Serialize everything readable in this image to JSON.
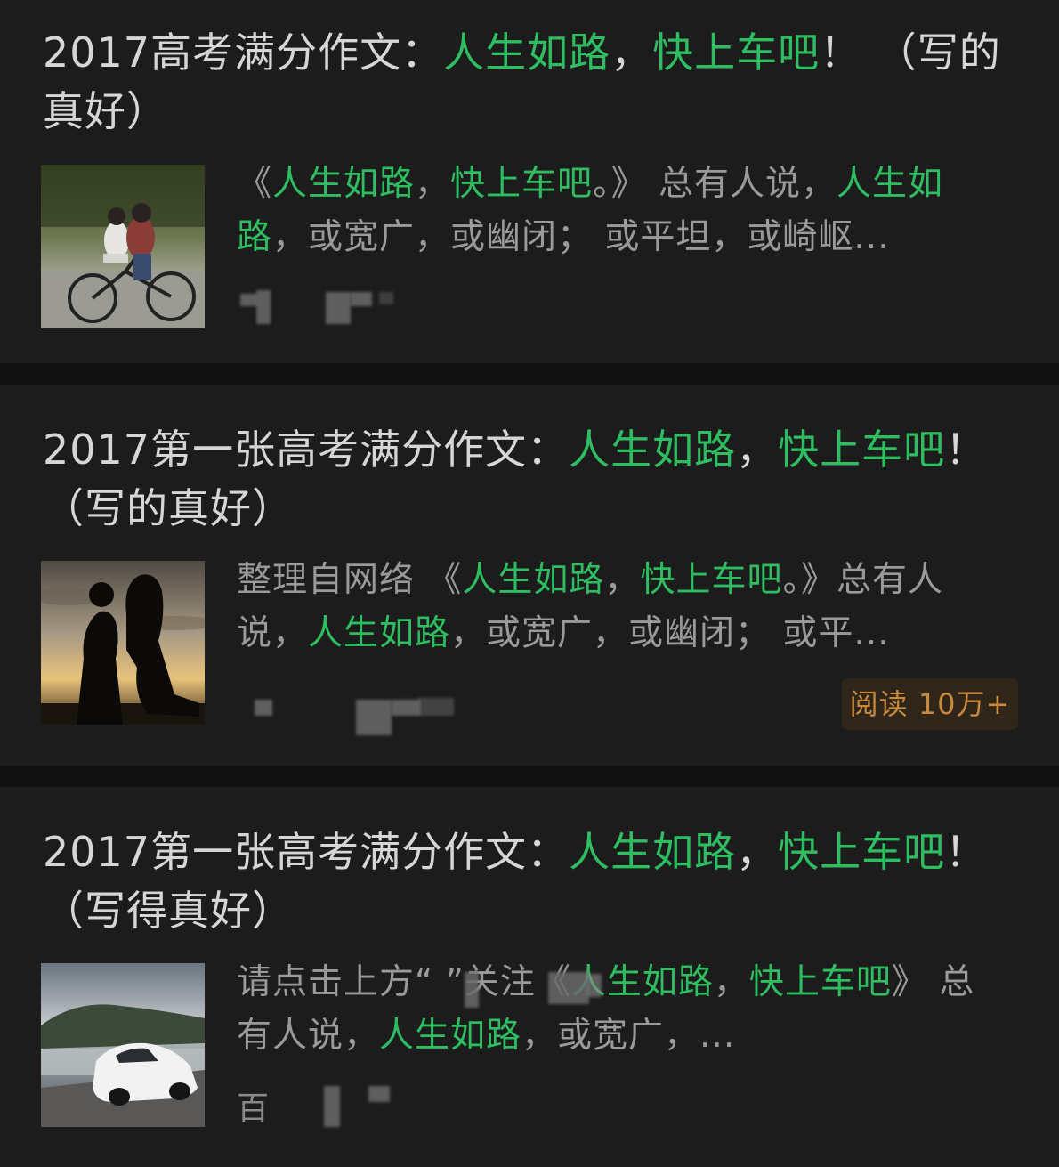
{
  "articles": [
    {
      "title_parts": [
        {
          "text": "2017高考满分作文：",
          "hl": false
        },
        {
          "text": "人生如路",
          "hl": true
        },
        {
          "text": "，",
          "hl": false
        },
        {
          "text": "快上车吧",
          "hl": true
        },
        {
          "text": "！ （写的真好）",
          "hl": false
        }
      ],
      "snippet_parts": [
        {
          "text": "《",
          "hl": false
        },
        {
          "text": "人生如路",
          "hl": true
        },
        {
          "text": "，",
          "hl": false
        },
        {
          "text": "快上车吧",
          "hl": true
        },
        {
          "text": "。》 总有人说，",
          "hl": false
        },
        {
          "text": "人生如路",
          "hl": true
        },
        {
          "text": "，或宽广，或幽闭； 或平坦，或崎岖...",
          "hl": false
        }
      ],
      "thumb_icon": "couple-bicycle-image"
    },
    {
      "title_parts": [
        {
          "text": "2017第一张高考满分作文：",
          "hl": false
        },
        {
          "text": "人生如路",
          "hl": true
        },
        {
          "text": "，",
          "hl": false
        },
        {
          "text": "快上车吧",
          "hl": true
        },
        {
          "text": "！ （写的真好）",
          "hl": false
        }
      ],
      "snippet_parts": [
        {
          "text": "整理自网络 《",
          "hl": false
        },
        {
          "text": "人生如路",
          "hl": true
        },
        {
          "text": "，",
          "hl": false
        },
        {
          "text": "快上车吧",
          "hl": true
        },
        {
          "text": "。》总有人说，",
          "hl": false
        },
        {
          "text": "人生如路",
          "hl": true
        },
        {
          "text": "，或宽广，或幽闭； 或平...",
          "hl": false
        }
      ],
      "read_badge": "阅读 10万+",
      "thumb_icon": "sunset-silhouette-image"
    },
    {
      "title_parts": [
        {
          "text": "2017第一张高考满分作文：",
          "hl": false
        },
        {
          "text": "人生如路",
          "hl": true
        },
        {
          "text": "，",
          "hl": false
        },
        {
          "text": "快上车吧",
          "hl": true
        },
        {
          "text": "！ （写得真好）",
          "hl": false
        }
      ],
      "snippet_parts": [
        {
          "text": "请点击上方“",
          "hl": false
        },
        {
          "text": "                ",
          "hl": false
        },
        {
          "text": "”关注《",
          "hl": false
        },
        {
          "text": "人生如路",
          "hl": true
        },
        {
          "text": "，",
          "hl": false
        },
        {
          "text": "快上车吧",
          "hl": true
        },
        {
          "text": "》 总有人说，",
          "hl": false
        },
        {
          "text": "人生如路",
          "hl": true
        },
        {
          "text": "，或宽广，...",
          "hl": false
        }
      ],
      "meta_fragment": "百",
      "thumb_icon": "white-sports-car-image"
    }
  ],
  "colors": {
    "background": "#111111",
    "card": "#1c1c1c",
    "highlight": "#2fbd62",
    "title": "#d6d6d6",
    "snippet": "#9a9a9a",
    "badge_bg": "#2f2519",
    "badge_text": "#c98a3e"
  }
}
